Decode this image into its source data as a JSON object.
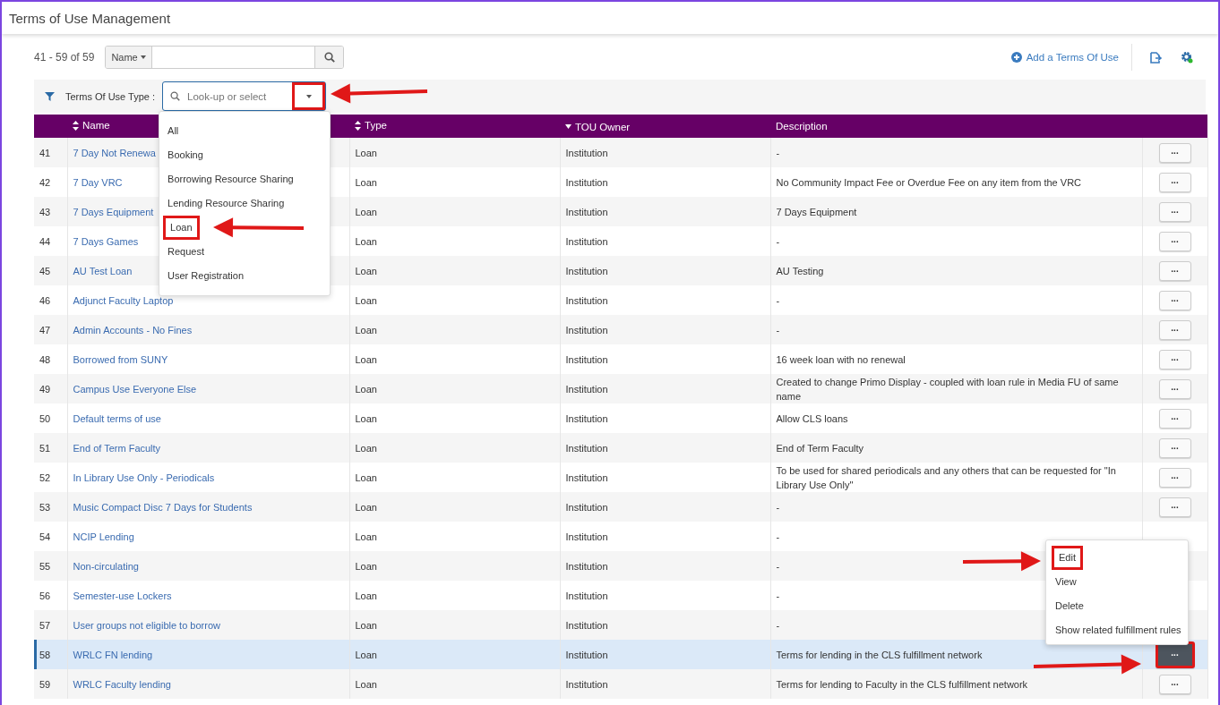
{
  "page_title": "Terms of Use Management",
  "toolbar": {
    "count": "41 - 59 of 59",
    "search_scope": "Name",
    "add_label": "Add a Terms Of Use"
  },
  "filter": {
    "label": "Terms Of Use Type :",
    "placeholder": "Look-up or select",
    "toggle_highlighted": true,
    "options": [
      {
        "label": "All",
        "highlighted": false
      },
      {
        "label": "Booking",
        "highlighted": false
      },
      {
        "label": "Borrowing Resource Sharing",
        "highlighted": false
      },
      {
        "label": "Lending Resource Sharing",
        "highlighted": false
      },
      {
        "label": "Loan",
        "highlighted": true
      },
      {
        "label": "Request",
        "highlighted": false
      },
      {
        "label": "User Registration",
        "highlighted": false
      }
    ]
  },
  "table": {
    "columns": [
      {
        "label": "Name",
        "kind": "sortable"
      },
      {
        "label": "Type",
        "kind": "sortable"
      },
      {
        "label": "TOU Owner",
        "kind": "sorted"
      },
      {
        "label": "Description",
        "kind": "plain"
      }
    ],
    "rows": [
      {
        "number": "41",
        "name": "7 Day Not Renewa",
        "type": "Loan",
        "owner": "Institution",
        "description": "-",
        "action": {
          "label": "...",
          "highlighted": false
        },
        "selected": false
      },
      {
        "number": "42",
        "name": "7 Day VRC",
        "type": "Loan",
        "owner": "Institution",
        "description": "No Community Impact Fee or Overdue Fee on any item from the VRC",
        "action": {
          "label": "...",
          "highlighted": false
        },
        "selected": false
      },
      {
        "number": "43",
        "name": "7 Days Equipment",
        "type": "Loan",
        "owner": "Institution",
        "description": "7 Days Equipment",
        "action": {
          "label": "...",
          "highlighted": false
        },
        "selected": false
      },
      {
        "number": "44",
        "name": "7 Days Games",
        "type": "Loan",
        "owner": "Institution",
        "description": "-",
        "action": {
          "label": "...",
          "highlighted": false
        },
        "selected": false
      },
      {
        "number": "45",
        "name": "AU Test Loan",
        "type": "Loan",
        "owner": "Institution",
        "description": "AU Testing",
        "action": {
          "label": "...",
          "highlighted": false
        },
        "selected": false
      },
      {
        "number": "46",
        "name": "Adjunct Faculty Laptop",
        "type": "Loan",
        "owner": "Institution",
        "description": "-",
        "action": {
          "label": "...",
          "highlighted": false
        },
        "selected": false
      },
      {
        "number": "47",
        "name": "Admin Accounts - No Fines",
        "type": "Loan",
        "owner": "Institution",
        "description": "-",
        "action": {
          "label": "...",
          "highlighted": false
        },
        "selected": false
      },
      {
        "number": "48",
        "name": "Borrowed from SUNY",
        "type": "Loan",
        "owner": "Institution",
        "description": "16 week loan with no renewal",
        "action": {
          "label": "...",
          "highlighted": false
        },
        "selected": false
      },
      {
        "number": "49",
        "name": "Campus Use Everyone Else",
        "type": "Loan",
        "owner": "Institution",
        "description": "Created to change Primo Display - coupled with loan rule in Media FU of same name",
        "action": {
          "label": "...",
          "highlighted": false
        },
        "selected": false
      },
      {
        "number": "50",
        "name": "Default terms of use",
        "type": "Loan",
        "owner": "Institution",
        "description": "Allow CLS loans",
        "action": {
          "label": "...",
          "highlighted": false
        },
        "selected": false
      },
      {
        "number": "51",
        "name": "End of Term Faculty",
        "type": "Loan",
        "owner": "Institution",
        "description": "End of Term Faculty",
        "action": {
          "label": "...",
          "highlighted": false
        },
        "selected": false
      },
      {
        "number": "52",
        "name": "In Library Use Only - Periodicals",
        "type": "Loan",
        "owner": "Institution",
        "description": "To be used for shared periodicals and any others that can be requested for \"In Library Use Only\"",
        "action": {
          "label": "...",
          "highlighted": false
        },
        "selected": false
      },
      {
        "number": "53",
        "name": "Music Compact Disc 7 Days for Students",
        "type": "Loan",
        "owner": "Institution",
        "description": "-",
        "action": {
          "label": "...",
          "highlighted": false
        },
        "selected": false
      },
      {
        "number": "54",
        "name": "NCIP Lending",
        "type": "Loan",
        "owner": "Institution",
        "description": "-",
        "selected": false
      },
      {
        "number": "55",
        "name": "Non-circulating",
        "type": "Loan",
        "owner": "Institution",
        "description": "-",
        "selected": false
      },
      {
        "number": "56",
        "name": "Semester-use Lockers",
        "type": "Loan",
        "owner": "Institution",
        "description": "-",
        "selected": false
      },
      {
        "number": "57",
        "name": "User groups not eligible to borrow",
        "type": "Loan",
        "owner": "Institution",
        "description": "-",
        "selected": false
      },
      {
        "number": "58",
        "name": "WRLC FN lending",
        "type": "Loan",
        "owner": "Institution",
        "description": "Terms for lending in the CLS fulfillment network",
        "action": {
          "label": "...",
          "highlighted": true
        },
        "selected": true
      },
      {
        "number": "59",
        "name": "WRLC Faculty lending",
        "type": "Loan",
        "owner": "Institution",
        "description": "Terms for lending to Faculty in the CLS fulfillment network",
        "action": {
          "label": "...",
          "highlighted": false
        },
        "selected": false
      }
    ]
  },
  "row_menu": {
    "items": [
      {
        "label": "Edit",
        "highlighted": true
      },
      {
        "label": "View",
        "highlighted": false
      },
      {
        "label": "Delete",
        "highlighted": false
      },
      {
        "label": "Show related fulfillment rules",
        "highlighted": false
      }
    ]
  }
}
